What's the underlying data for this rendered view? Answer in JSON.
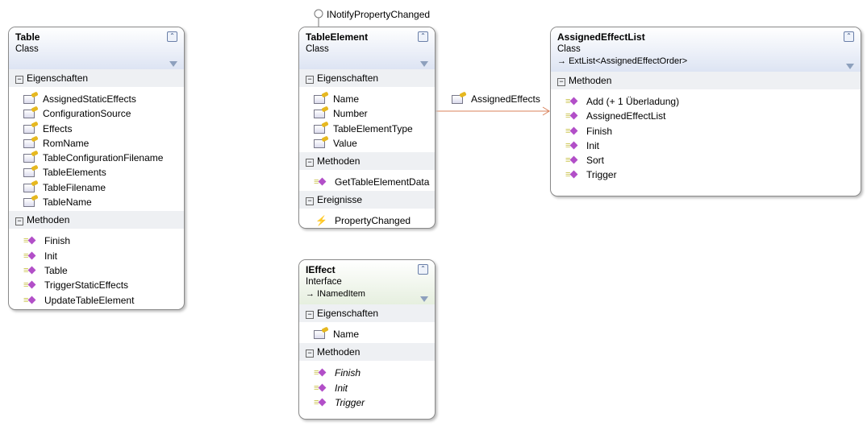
{
  "boxes": [
    {
      "id": "table",
      "title": "Table",
      "kind": "Class",
      "sections": [
        {
          "label": "Eigenschaften",
          "type": "prop",
          "items": [
            "AssignedStaticEffects",
            "ConfigurationSource",
            "Effects",
            "RomName",
            "TableConfigurationFilename",
            "TableElements",
            "TableFilename",
            "TableName"
          ]
        },
        {
          "label": "Methoden",
          "type": "meth",
          "items": [
            "Finish",
            "Init",
            "Table",
            "TriggerStaticEffects",
            "UpdateTableElement"
          ]
        }
      ]
    },
    {
      "id": "tableelement",
      "title": "TableElement",
      "kind": "Class",
      "sections": [
        {
          "label": "Eigenschaften",
          "type": "prop",
          "items": [
            "Name",
            "Number",
            "TableElementType",
            "Value"
          ]
        },
        {
          "label": "Methoden",
          "type": "meth",
          "items": [
            "GetTableElementData"
          ]
        },
        {
          "label": "Ereignisse",
          "type": "evt",
          "items": [
            "PropertyChanged"
          ]
        }
      ]
    },
    {
      "id": "assignedeffectlist",
      "title": "AssignedEffectList",
      "kind": "Class",
      "base": "ExtList<AssignedEffectOrder>",
      "sections": [
        {
          "label": "Methoden",
          "type": "meth",
          "items": [
            "Add (+ 1 Überladung)",
            "AssignedEffectList",
            "Finish",
            "Init",
            "Sort",
            "Trigger"
          ]
        }
      ]
    },
    {
      "id": "ieffect",
      "title": "IEffect",
      "kind": "Interface",
      "base": "INamedItem",
      "sections": [
        {
          "label": "Eigenschaften",
          "type": "prop",
          "items": [
            "Name"
          ]
        },
        {
          "label": "Methoden",
          "type": "meth",
          "italic": true,
          "items": [
            "Finish",
            "Init",
            "Trigger"
          ]
        }
      ]
    }
  ],
  "lollipop": {
    "label": "INotifyPropertyChanged"
  },
  "association": {
    "label": "AssignedEffects",
    "color": "#d9825b"
  },
  "icons": {
    "collapse": "double-chevron-up-icon",
    "filter": "filter-icon",
    "property": "property-icon",
    "method": "method-icon",
    "event": "event-icon"
  }
}
